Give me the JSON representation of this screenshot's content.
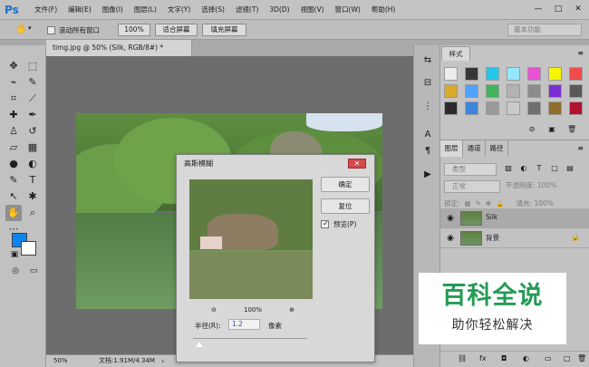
{
  "app": {
    "logo": "Ps",
    "menus": [
      "文件(F)",
      "编辑(E)",
      "图像(I)",
      "图层(L)",
      "文字(Y)",
      "选择(S)",
      "滤镜(T)",
      "3D(D)",
      "视图(V)",
      "窗口(W)",
      "帮助(H)"
    ]
  },
  "options": {
    "scroll_all": "滚动所有窗口",
    "zoom_100": "100%",
    "fit_screen": "适合屏幕",
    "fill_screen": "填充屏幕",
    "workspace": "基本功能"
  },
  "document": {
    "tab": "timg.jpg @ 50% (Silk, RGB/8#) *",
    "zoom_status": "50%",
    "doc_status": "文档:1.91M/4.34M"
  },
  "dialog": {
    "title": "高斯模糊",
    "ok": "确定",
    "reset": "复位",
    "preview": "预览(P)",
    "preview_zoom": "100%",
    "radius_label": "半径(R):",
    "radius_value": "1.2",
    "radius_unit": "像素"
  },
  "styles": {
    "tab": "样式",
    "swatches": [
      "#d9d9d9",
      "#363636",
      "#23c7e8",
      "#95e7ff",
      "#ea52d4",
      "#f6f600",
      "#ef4b4b",
      "#d9a92b",
      "#4fa3ff",
      "#40b35b",
      "#b2b2b2",
      "#8c8c8c",
      "#7c2fd3",
      "#595959",
      "#2b2b2b",
      "#3e84db",
      "#9a9a9a",
      "#c9c9c9",
      "#6f6f6f",
      "#8e6e28",
      "#b4122e"
    ]
  },
  "layers": {
    "tabs": [
      "图层",
      "通道",
      "路径"
    ],
    "filter": "类型",
    "blend": "正常",
    "opacity": "不透明度: 100%",
    "lock": "锁定:",
    "fill": "填充: 100%",
    "items": [
      {
        "name": "Silk"
      },
      {
        "name": "背景"
      }
    ]
  },
  "watermark": {
    "title": "百科全说",
    "subtitle": "助你轻松解决"
  }
}
